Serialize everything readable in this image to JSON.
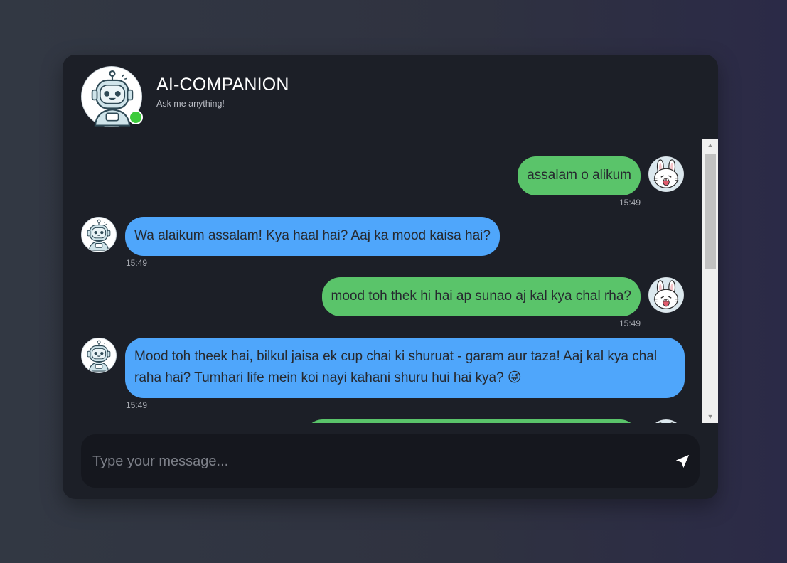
{
  "header": {
    "title": "AI-COMPANION",
    "subtitle": "Ask me anything!",
    "status": "online"
  },
  "messages": [
    {
      "sender": "user",
      "text": "assalam o alikum",
      "time": "15:49"
    },
    {
      "sender": "bot",
      "text": "Wa alaikum assalam! Kya haal hai? Aaj ka mood kaisa hai?",
      "time": "15:49"
    },
    {
      "sender": "user",
      "text": "mood toh thek hi hai ap sunao aj kal kya chal rha?",
      "time": "15:49"
    },
    {
      "sender": "bot",
      "text": "Mood toh theek hai, bilkul jaisa ek cup chai ki shuruat - garam aur taza! Aaj kal kya chal raha hai? Tumhari life mein koi nayi kahani shuru hui hai kya? 😜",
      "time": "15:49"
    }
  ],
  "composer": {
    "placeholder": "Type your message...",
    "value": ""
  },
  "icons": {
    "send": "send-arrow-icon",
    "bot_avatar": "robot-icon",
    "user_avatar": "bunny-icon",
    "scroll_up": "arrow-up-icon",
    "scroll_down": "arrow-down-icon"
  },
  "colors": {
    "user_bubble": "#5ac46a",
    "bot_bubble": "#4fa6fb",
    "online": "#3ecb3c",
    "card_bg": "#1c1f27"
  }
}
